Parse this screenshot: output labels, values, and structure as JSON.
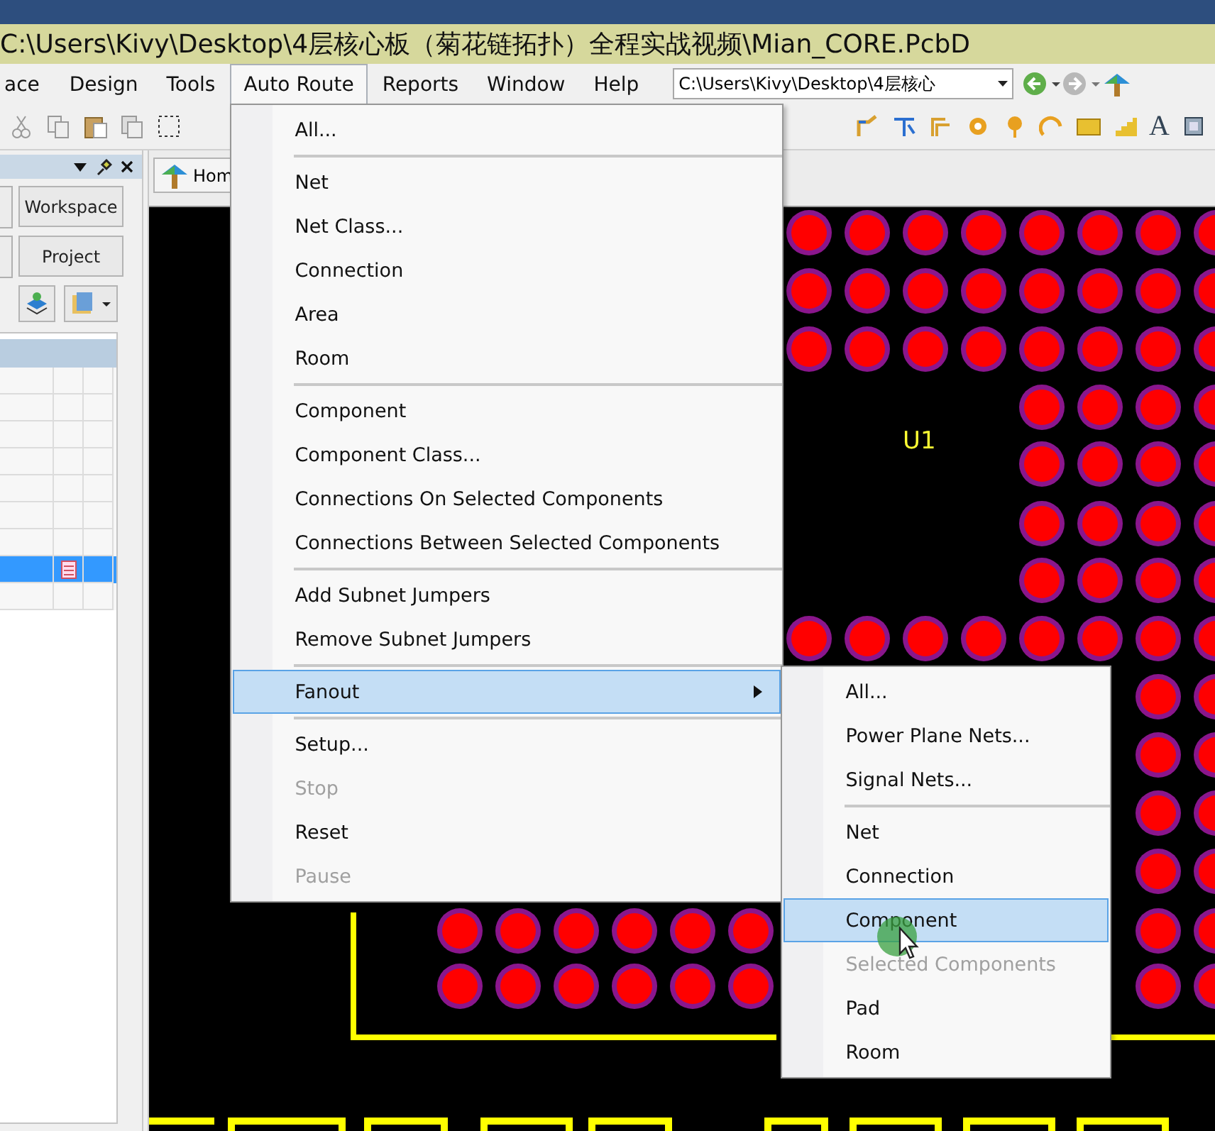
{
  "window": {
    "title": "C:\\Users\\Kivy\\Desktop\\4层核心板（菊花链拓扑）全程实战视频\\Mian_CORE.PcbD"
  },
  "menu_bar": {
    "items": [
      {
        "label": "ace",
        "selected": false
      },
      {
        "label": "Design",
        "selected": false
      },
      {
        "label": "Tools",
        "selected": false
      },
      {
        "label": "Auto Route",
        "selected": true
      },
      {
        "label": "Reports",
        "selected": false
      },
      {
        "label": "Window",
        "selected": false
      },
      {
        "label": "Help",
        "selected": false
      }
    ],
    "path_field": {
      "value": "C:\\Users\\Kivy\\Desktop\\4层核心"
    }
  },
  "toolbar": {
    "text_tool": "A"
  },
  "left_panel": {
    "buttons": [
      "Workspace",
      "Project"
    ],
    "table": {
      "rows": [
        {
          "selected": false,
          "has_document_icon": false
        },
        {
          "selected": false,
          "has_document_icon": false
        },
        {
          "selected": false,
          "has_document_icon": false
        },
        {
          "selected": false,
          "has_document_icon": false
        },
        {
          "selected": false,
          "has_document_icon": false
        },
        {
          "selected": false,
          "has_document_icon": false
        },
        {
          "selected": false,
          "has_document_icon": false
        },
        {
          "selected": true,
          "has_document_icon": true
        },
        {
          "selected": false,
          "has_document_icon": false
        }
      ]
    }
  },
  "document_tab": {
    "label": "Hom"
  },
  "board": {
    "designator": "U1"
  },
  "menu": {
    "items": [
      {
        "kind": "item",
        "label": "All...",
        "disabled": false,
        "selected": false,
        "has_submenu": false
      },
      {
        "kind": "separator"
      },
      {
        "kind": "item",
        "label": "Net",
        "disabled": false,
        "selected": false,
        "has_submenu": false
      },
      {
        "kind": "item",
        "label": "Net Class...",
        "disabled": false,
        "selected": false,
        "has_submenu": false
      },
      {
        "kind": "item",
        "label": "Connection",
        "disabled": false,
        "selected": false,
        "has_submenu": false
      },
      {
        "kind": "item",
        "label": "Area",
        "disabled": false,
        "selected": false,
        "has_submenu": false
      },
      {
        "kind": "item",
        "label": "Room",
        "disabled": false,
        "selected": false,
        "has_submenu": false
      },
      {
        "kind": "separator"
      },
      {
        "kind": "item",
        "label": "Component",
        "disabled": false,
        "selected": false,
        "has_submenu": false
      },
      {
        "kind": "item",
        "label": "Component Class...",
        "disabled": false,
        "selected": false,
        "has_submenu": false
      },
      {
        "kind": "item",
        "label": "Connections On Selected Components",
        "disabled": false,
        "selected": false,
        "has_submenu": false
      },
      {
        "kind": "item",
        "label": "Connections Between Selected Components",
        "disabled": false,
        "selected": false,
        "has_submenu": false
      },
      {
        "kind": "separator"
      },
      {
        "kind": "item",
        "label": "Add Subnet Jumpers",
        "disabled": false,
        "selected": false,
        "has_submenu": false
      },
      {
        "kind": "item",
        "label": "Remove Subnet Jumpers",
        "disabled": false,
        "selected": false,
        "has_submenu": false
      },
      {
        "kind": "separator"
      },
      {
        "kind": "item",
        "label": "Fanout",
        "disabled": false,
        "selected": true,
        "has_submenu": true
      },
      {
        "kind": "separator"
      },
      {
        "kind": "item",
        "label": "Setup...",
        "disabled": false,
        "selected": false,
        "has_submenu": false
      },
      {
        "kind": "item",
        "label": "Stop",
        "disabled": true,
        "selected": false,
        "has_submenu": false
      },
      {
        "kind": "item",
        "label": "Reset",
        "disabled": false,
        "selected": false,
        "has_submenu": false
      },
      {
        "kind": "item",
        "label": "Pause",
        "disabled": true,
        "selected": false,
        "has_submenu": false
      }
    ]
  },
  "submenu": {
    "items": [
      {
        "kind": "item",
        "label": "All...",
        "disabled": false,
        "selected": false,
        "has_submenu": false
      },
      {
        "kind": "item",
        "label": "Power Plane Nets...",
        "disabled": false,
        "selected": false,
        "has_submenu": false
      },
      {
        "kind": "item",
        "label": "Signal Nets...",
        "disabled": false,
        "selected": false,
        "has_submenu": false
      },
      {
        "kind": "separator"
      },
      {
        "kind": "item",
        "label": "Net",
        "disabled": false,
        "selected": false,
        "has_submenu": false
      },
      {
        "kind": "item",
        "label": "Connection",
        "disabled": false,
        "selected": false,
        "has_submenu": false
      },
      {
        "kind": "item",
        "label": "Component",
        "disabled": false,
        "selected": true,
        "has_submenu": false
      },
      {
        "kind": "item",
        "label": "Selected Components",
        "disabled": true,
        "selected": false,
        "has_submenu": false
      },
      {
        "kind": "item",
        "label": "Pad",
        "disabled": false,
        "selected": false,
        "has_submenu": false
      },
      {
        "kind": "item",
        "label": "Room",
        "disabled": false,
        "selected": false,
        "has_submenu": false
      }
    ]
  }
}
